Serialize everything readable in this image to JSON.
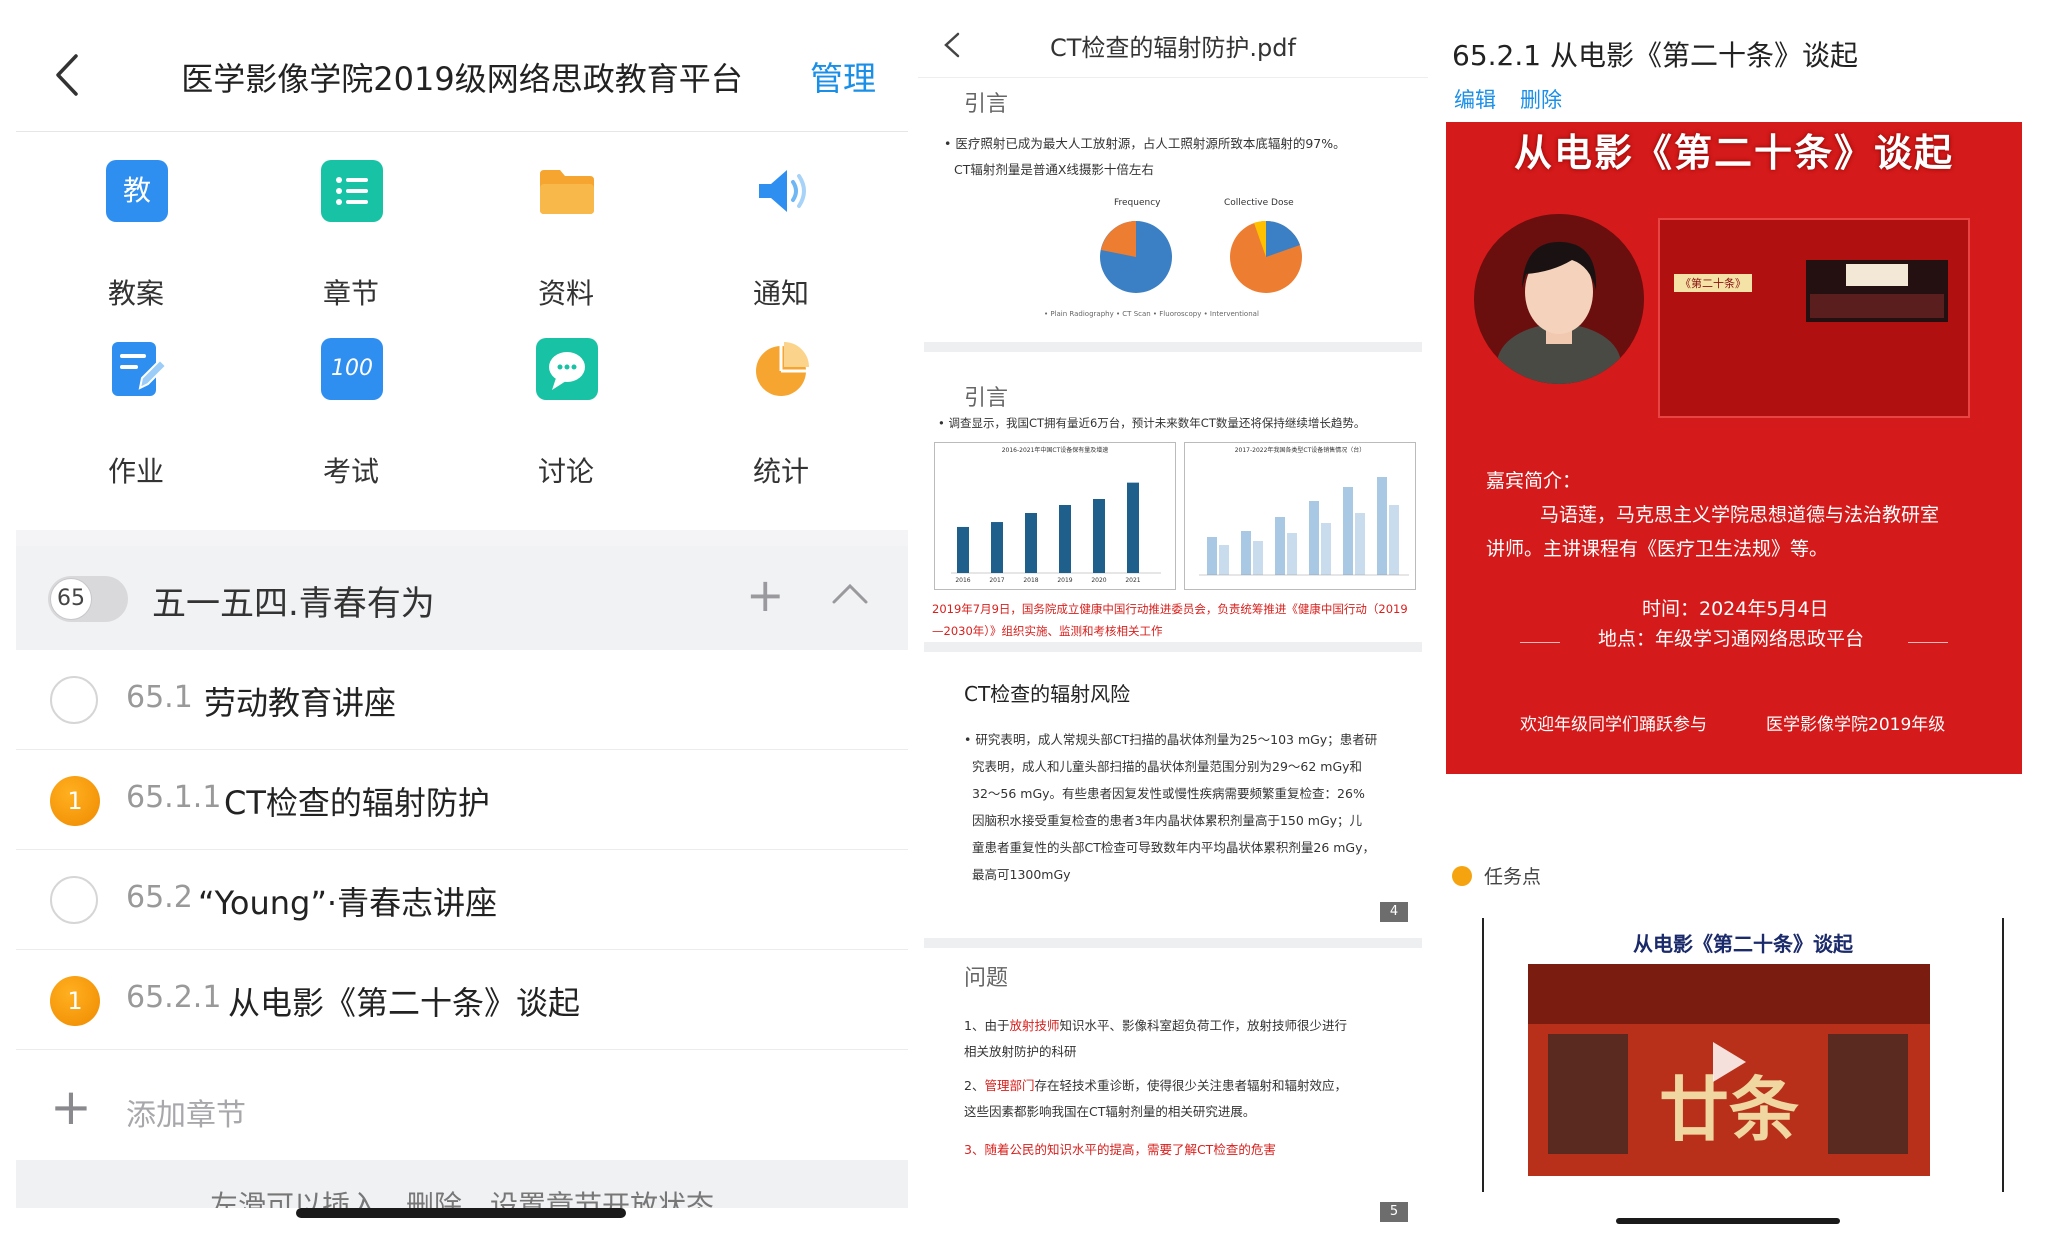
{
  "left": {
    "header": {
      "title": "医学影像学院2019级网络思政教育平台",
      "manage": "管理"
    },
    "grid": [
      {
        "label": "教案",
        "glyph": "教",
        "icon": "lesson-plan-icon",
        "color": "#2f8ff0"
      },
      {
        "label": "章节",
        "icon": "chapter-list-icon",
        "color": "#18c2a4"
      },
      {
        "label": "资料",
        "icon": "folder-icon",
        "color": "#f6a531"
      },
      {
        "label": "通知",
        "icon": "speaker-icon",
        "color": "#2f8ff0"
      },
      {
        "label": "作业",
        "icon": "homework-icon",
        "color": "#2f8ff0"
      },
      {
        "label": "考试",
        "glyph": "100",
        "icon": "exam-icon",
        "color": "#2f8ff0"
      },
      {
        "label": "讨论",
        "icon": "discussion-icon",
        "color": "#18c2a4"
      },
      {
        "label": "统计",
        "icon": "pie-chart-icon",
        "color": "#f6a531"
      }
    ],
    "chapter": {
      "number": "65",
      "title": "五一五四.青春有为"
    },
    "rows": [
      {
        "num": "65.1",
        "title": "劳动教育讲座",
        "badge": ""
      },
      {
        "num": "65.1.1",
        "title": "CT检查的辐射防护",
        "badge": "1"
      },
      {
        "num": "65.2",
        "title": "“Young”·青春志讲座",
        "badge": ""
      },
      {
        "num": "65.2.1",
        "title": "从电影《第二十条》谈起",
        "badge": "1"
      }
    ],
    "add_chapter": "添加章节",
    "hint": "左滑可以插入、删除、设置章节开放状态"
  },
  "mid": {
    "header": {
      "title": "CT检查的辐射防护.pdf"
    },
    "slide1": {
      "heading": "引言",
      "text1": "• 医疗照射已成为最大人工放射源，占人工照射源所致本底辐射的97%。",
      "text2": "CT辐射剂量是普通X线摄影十倍左右",
      "pie1_title": "Frequency",
      "pie2_title": "Collective Dose",
      "pie_legend": "• Plain Radiography • CT Scan • Fluoroscopy • Interventional"
    },
    "slide2": {
      "heading": "引言",
      "text1": "• 调查显示，我国CT拥有量近6万台，预计未来数年CT数量还将保持继续增长趋势。",
      "chart1_title": "2016-2021年中国CT设备保有量及增速",
      "chart2_title": "2017-2022年我国各类型CT设备销售情况（台）",
      "note": "2019年7月9日，国务院成立健康中国行动推进委员会，负责统筹推进《健康中国行动（2019—2030年）》组织实施、监测和考核相关工作"
    },
    "chart1": {
      "categories": [
        "2016",
        "2017",
        "2018",
        "2019",
        "2020",
        "2021"
      ],
      "values": [
        23023,
        25480,
        30000,
        34000,
        37000,
        45182
      ]
    },
    "slide3": {
      "heading": "CT检查的辐射风险",
      "lines": [
        "• 研究表明，成人常规头部CT扫描的晶状体剂量为25～103 mGy；患者研",
        "究表明，成人和儿童头部扫描的晶状体剂量范围分别为29～62 mGy和",
        "32～56 mGy。有些患者因复发性或慢性疾病需要频繁重复检查：26%",
        "因脑积水接受重复检查的患者3年内晶状体累积剂量高于150 mGy；儿",
        "童患者重复性的头部CT检查可导致数年内平均晶状体累积剂量26 mGy，",
        "最高可1300mGy"
      ],
      "page": "4"
    },
    "slide4": {
      "heading": "问题",
      "p1_prefix": "1、由于",
      "p1_red": "放射技师",
      "p1_rest": "知识水平、影像科室超负荷工作，放射技师很少进行",
      "p1_line2": "相关放射防护的科研",
      "p2_prefix": "2、",
      "p2_red": "管理部门",
      "p2_rest": "存在轻技术重诊断，使得很少关注患者辐射和辐射效应，",
      "p2_line2": "这些因素都影响我国在CT辐射剂量的相关研究进展。",
      "p3": "3、随着公民的知识水平的提高，需要了解CT检查的危害",
      "page": "5"
    }
  },
  "right": {
    "title": "65.2.1 从电影《第二十条》谈起",
    "edit": "编辑",
    "delete": "删除",
    "poster": {
      "title": "从电影《第二十条》谈起",
      "guest_label": "嘉宾简介：",
      "guest_line1": "马语莲，马克思主义学院思想道德与法治教研室",
      "guest_line2": "讲师。主讲课程有《医疗卫生法规》等。",
      "time": "时间：2024年5月4日",
      "place": "地点：年级学习通网络思政平台",
      "welcome": "欢迎年级同学们踊跃参与",
      "org": "医学影像学院2019年级",
      "inner_tag": "《第二十条》"
    },
    "task_label": "任务点",
    "video": {
      "title": "从电影《第二十条》谈起"
    }
  }
}
